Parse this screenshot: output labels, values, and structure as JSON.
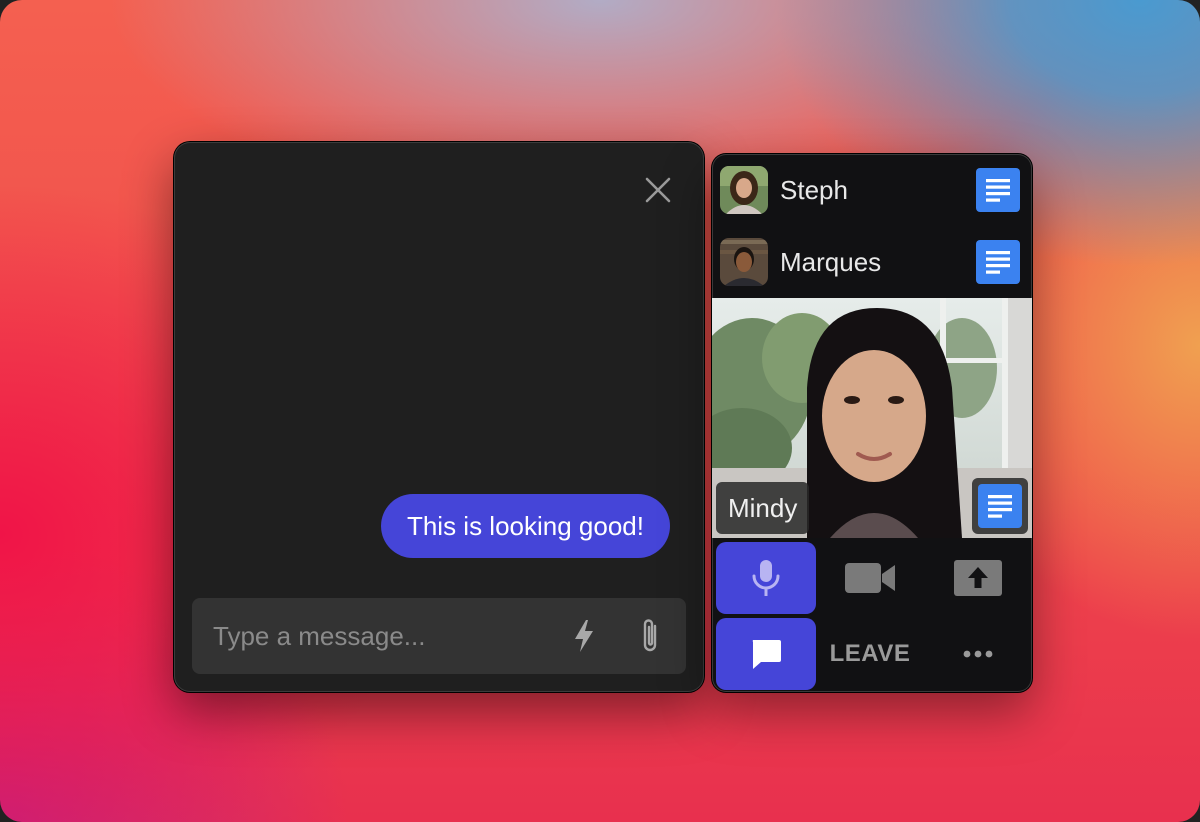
{
  "chat": {
    "close_icon": "close-icon",
    "messages": [
      {
        "text": "This is looking good!",
        "from": "self"
      }
    ],
    "composer": {
      "placeholder": "Type a message...",
      "value": "",
      "tools": [
        "lightning-icon",
        "paperclip-icon"
      ]
    }
  },
  "call": {
    "participants": [
      {
        "name": "Steph",
        "avatar": "avatar-steph",
        "notes_icon": "notes-icon"
      },
      {
        "name": "Marques",
        "avatar": "avatar-marques",
        "notes_icon": "notes-icon"
      }
    ],
    "active_speaker": {
      "name": "Mindy",
      "notes_icon": "notes-icon"
    },
    "controls": {
      "microphone": {
        "icon": "microphone-icon",
        "active": true
      },
      "camera": {
        "icon": "video-camera-icon",
        "active": false
      },
      "share": {
        "icon": "share-screen-icon",
        "active": false
      },
      "chat": {
        "icon": "chat-bubble-icon",
        "active": true
      },
      "leave_label": "LEAVE",
      "more": {
        "icon": "more-icon"
      }
    }
  },
  "colors": {
    "accent": "#4545d8",
    "notes_blue": "#3b82f0",
    "chat_bg": "#1f1f1f",
    "panel_bg": "#111113"
  }
}
